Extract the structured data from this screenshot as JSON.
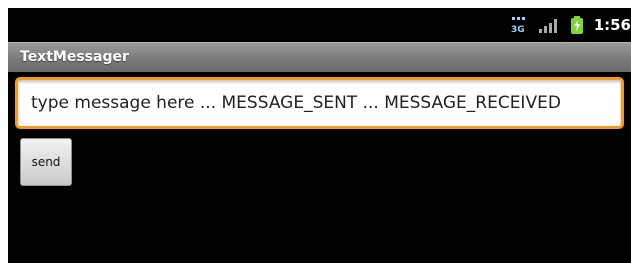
{
  "status_bar": {
    "network_icon": "3g-icon",
    "signal_icon": "signal-strength-icon",
    "battery_icon": "battery-charging-icon",
    "time": "1:56",
    "colors": {
      "network": "#9ad1ff",
      "signal": "#a9a9a9",
      "battery": "#7fd33a"
    }
  },
  "title_bar": {
    "title": "TextMessager"
  },
  "message_input": {
    "value": "type message here ... MESSAGE_SENT ... MESSAGE_RECEIVED",
    "focus_color": "#f39a1f"
  },
  "send_button": {
    "label": "send"
  }
}
